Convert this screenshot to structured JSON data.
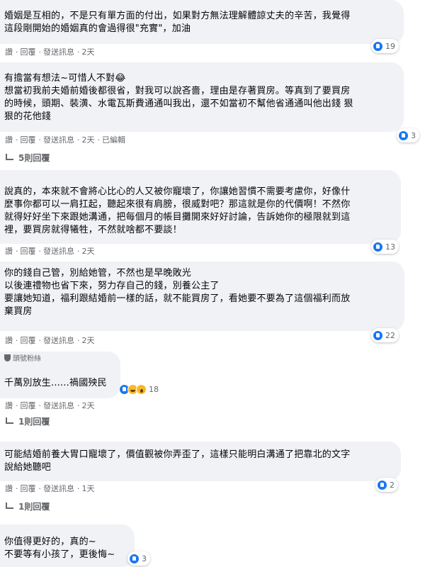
{
  "actions": {
    "like": "讚",
    "reply": "回覆",
    "message": "發送訊息",
    "edited": "已編輯"
  },
  "comments": [
    {
      "author": "",
      "text": "婚姻是互相的，不是只有單方面的付出，如果對方無法理解體諒丈夫的辛苦，我覺得\n這段剛開始的婚姻真的會過得很\"充實\"，加油",
      "time": "2天",
      "reactions": [
        "like"
      ],
      "reaction_count": "19"
    },
    {
      "author": "",
      "text": "有擔當有想法~可惜人不對😂\n想當初我前夫婚前婚後都很省，對我可以說吝嗇，理由是存著買房。等真到了要買房\n的時候，頭期、裝潢、水電瓦斯費通通叫我出，還不如當初不幫他省通通叫他出錢 狠\n狠的花他錢",
      "time": "2天",
      "edited": true,
      "reactions": [
        "like"
      ],
      "reaction_count": "3",
      "replies_label": "5則回覆"
    },
    {
      "author": "",
      "text": "說真的，本來就不會將心比心的人又被你寵壞了，你讓她習慣不需要考慮你，好像什\n麼事你都可以一肩扛起，聽起來很有肩膀，很威對吧？那這就是你的代價啊！不然你\n就得好好坐下來跟她溝通，把每個月的帳目攤開來好好討論，告訴她你的極限就到這\n裡，要買房就得犧牲，不然就啥都不要談！",
      "time": "2天",
      "reactions": [
        "like"
      ],
      "reaction_count": "13"
    },
    {
      "author": "",
      "text": "你的錢自己管，別給她管，不然也是早晚敗光\n以後連禮物也省下來，努力存自己的錢，別養公主了\n要讓她知道，福利跟結婚前一樣的話，就不能買房了，看她要不要為了這個福利而放\n棄買房",
      "time": "2天",
      "reactions": [
        "like"
      ],
      "reaction_count": "22"
    },
    {
      "badge": "頭號粉絲",
      "author": "",
      "text": "千萬別放生......禍國殃民",
      "time": "2天",
      "reactions": [
        "like",
        "haha",
        "wow"
      ],
      "reaction_count": "18",
      "replies_label": "1則回覆"
    },
    {
      "author": "",
      "text": "可能結婚前養大胃口寵壞了，價值觀被你弄歪了，這樣只能明白溝通了把靠北的文字\n說給她聽吧",
      "time": "1天",
      "reactions": [
        "like"
      ],
      "reaction_count": "2",
      "replies_label": "1則回覆"
    },
    {
      "author": "",
      "text": "你值得更好的，真的~\n不要等有小孩了，更後悔~",
      "reactions": [
        "like"
      ],
      "reaction_count": "3"
    }
  ]
}
